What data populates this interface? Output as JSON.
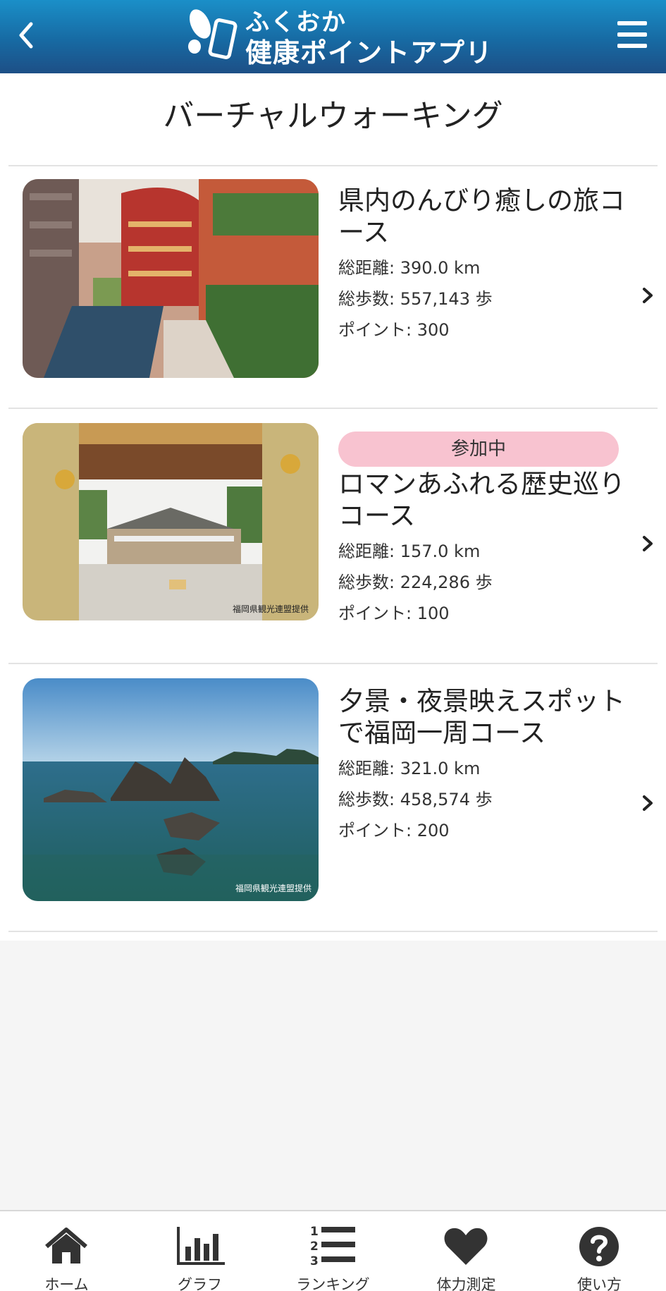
{
  "header": {
    "logo_line1": "ふくおか",
    "logo_line2": "健康ポイントアプリ",
    "bg_color": "#176aa3"
  },
  "page_title": "バーチャルウォーキング",
  "courses": [
    {
      "name": "県内のんびり癒しの旅コース",
      "distance": "総距離: 390.0 km",
      "steps": "総歩数: 557,143 歩",
      "points": "ポイント: 300",
      "badge": ""
    },
    {
      "name": "ロマンあふれる歴史巡りコース",
      "distance": "総距離: 157.0 km",
      "steps": "総歩数: 224,286 歩",
      "points": "ポイント: 100",
      "badge": "参加中",
      "photo_credit": "福岡県観光連盟提供"
    },
    {
      "name": "夕景・夜景映えスポットで福岡一周コース",
      "distance": "総距離: 321.0 km",
      "steps": "総歩数: 458,574 歩",
      "points": "ポイント: 200",
      "badge": "",
      "photo_credit": "福岡県観光連盟提供"
    }
  ],
  "tabs": [
    {
      "label": "ホーム",
      "icon": "home-icon"
    },
    {
      "label": "グラフ",
      "icon": "bar-chart-icon"
    },
    {
      "label": "ランキング",
      "icon": "ranking-icon"
    },
    {
      "label": "体力測定",
      "icon": "heart-icon"
    },
    {
      "label": "使い方",
      "icon": "help-icon"
    }
  ],
  "colors": {
    "badge": "#f8c3d0",
    "divider": "#e3e3e3",
    "background_empty": "#f5f5f5"
  }
}
